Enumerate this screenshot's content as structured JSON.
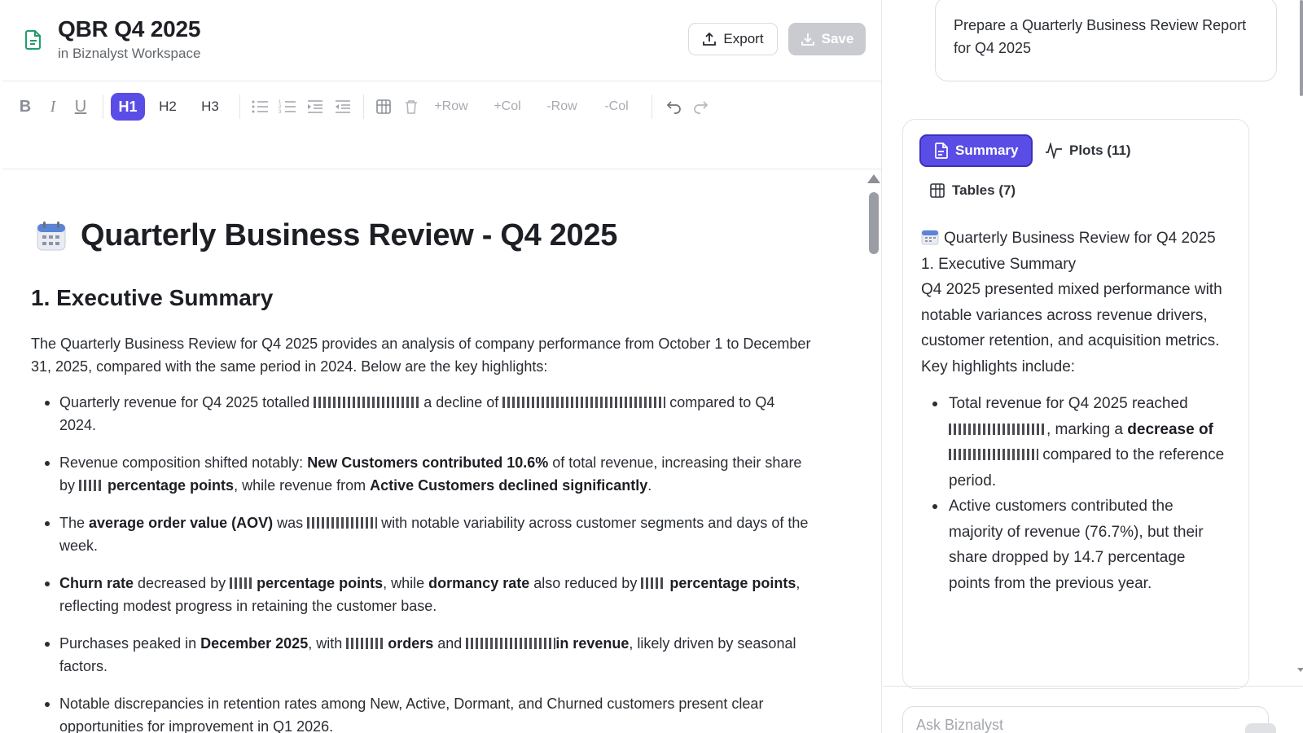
{
  "header": {
    "title": "QBR Q4 2025",
    "subtitle": "in Biznalyst Workspace",
    "export_label": "Export",
    "save_label": "Save"
  },
  "toolbar": {
    "bold": "B",
    "italic": "I",
    "underline": "U",
    "h1": "H1",
    "h2": "H2",
    "h3": "H3",
    "add_row": "+Row",
    "add_col": "+Col",
    "del_row": "-Row",
    "del_col": "-Col"
  },
  "document": {
    "title": "Quarterly Business Review - Q4 2025",
    "section1": "1. Executive Summary",
    "intro": "The Quarterly Business Review for Q4 2025 provides an analysis of company performance from October 1 to December 31, 2025, compared with the same period in 2024. Below are the key highlights:",
    "b1_pre": "Quarterly revenue for Q4 2025 totalled ",
    "b1_mid": " a decline of ",
    "b1_post": " compared to Q4 2024.",
    "b2_pre": "Revenue composition shifted notably: ",
    "b2_bold1": "New Customers contributed 10.6%",
    "b2_mid": " of total revenue, increasing their share by ",
    "b2_bold2": "percentage points",
    "b2_mid2": ", while revenue from ",
    "b2_bold3": "Active Customers declined significantly",
    "b2_end": ".",
    "b3_pre": "The ",
    "b3_bold1": "average order value (AOV)",
    "b3_mid": " was ",
    "b3_post": " with notable variability across customer segments and days of the week.",
    "b4_bold1": "Churn rate",
    "b4_mid": " decreased by ",
    "b4_bold2": "percentage points",
    "b4_mid2": ", while ",
    "b4_bold3": "dormancy rate",
    "b4_mid3": " also reduced by ",
    "b4_bold4": "percentage points",
    "b4_post": ", reflecting modest progress in retaining the customer base.",
    "b5_pre": "Purchases peaked in ",
    "b5_bold1": "December 2025",
    "b5_mid": ", with ",
    "b5_bold2": "orders",
    "b5_mid2": " and ",
    "b5_bold3": "in revenue",
    "b5_post": ", likely driven by seasonal factors.",
    "b6": "Notable discrepancies in retention rates among New, Active, Dormant, and Churned customers present clear opportunities for improvement in Q1 2026."
  },
  "side": {
    "prompt": "Prepare a Quarterly Business Review Report for Q4 2025",
    "tabs": {
      "summary": "Summary",
      "plots": "Plots (11)",
      "tables": "Tables (7)"
    },
    "summary_title": "Quarterly Business Review for Q4 2025",
    "summary_section": "1. Executive Summary",
    "summary_para": "Q4 2025 presented mixed performance with notable variances across revenue drivers, customer retention, and acquisition metrics. Key highlights include:",
    "sb1_pre": "Total revenue for Q4 2025 reached ",
    "sb1_mid": ", marking a ",
    "sb1_bold": "decrease of",
    "sb1_post": " compared to the reference period.",
    "sb2": "Active customers contributed the majority of revenue (76.7%), but their share dropped by 14.7 percentage points from the previous year.",
    "ask_placeholder": "Ask Biznalyst"
  }
}
